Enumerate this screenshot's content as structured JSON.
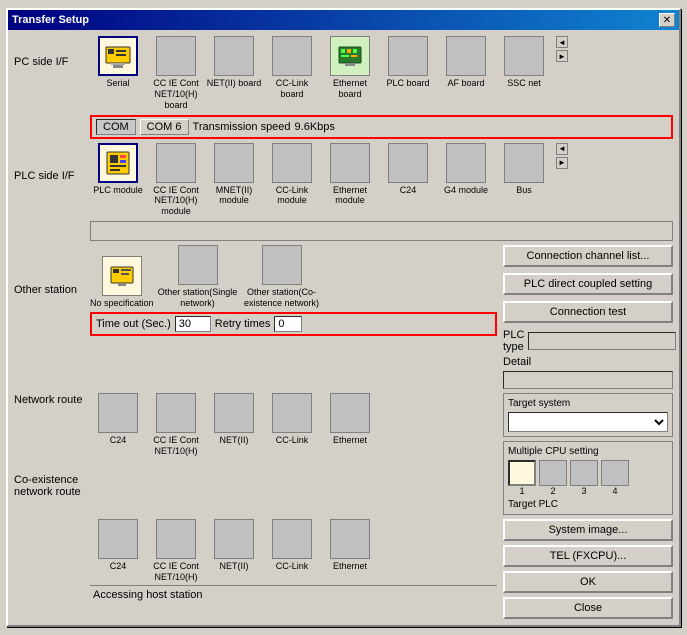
{
  "window": {
    "title": "Transfer Setup",
    "close_btn": "✕"
  },
  "pc_if": {
    "label": "PC side I/F",
    "icons": [
      {
        "id": "serial",
        "label": "Serial",
        "selected": true,
        "emoji": "🖥"
      },
      {
        "id": "cc_ie_cont_net10h_board",
        "label": "CC IE Cont NET/10(H) board",
        "selected": false,
        "emoji": ""
      },
      {
        "id": "netii_board",
        "label": "NET(II) board",
        "selected": false,
        "emoji": ""
      },
      {
        "id": "cc_link_board",
        "label": "CC-Link board",
        "selected": false,
        "emoji": ""
      },
      {
        "id": "ethernet_board",
        "label": "Ethernet board",
        "selected": false,
        "emoji": "🌐"
      },
      {
        "id": "plc_board",
        "label": "PLC board",
        "selected": false,
        "emoji": ""
      },
      {
        "id": "af_board",
        "label": "AF board",
        "selected": false,
        "emoji": ""
      },
      {
        "id": "ssc_net",
        "label": "SSC net",
        "selected": false,
        "emoji": ""
      }
    ],
    "com_bar": {
      "com_label": "COM",
      "com6_label": "COM 6",
      "speed_label": "Transmission speed",
      "speed_value": "9.6Kbps"
    }
  },
  "plc_if": {
    "label": "PLC side I/F",
    "icons": [
      {
        "id": "plc_module",
        "label": "PLC module",
        "selected": true,
        "emoji": "📋"
      },
      {
        "id": "cc_ie_cont_net10h_module",
        "label": "CC IE Cont NET/10(H) module",
        "selected": false,
        "emoji": ""
      },
      {
        "id": "mnetii_module",
        "label": "MNET(II) module",
        "selected": false,
        "emoji": ""
      },
      {
        "id": "cc_link_module",
        "label": "CC-Link module",
        "selected": false,
        "emoji": ""
      },
      {
        "id": "ethernet_module",
        "label": "Ethernet module",
        "selected": false,
        "emoji": ""
      },
      {
        "id": "c24_module",
        "label": "C24",
        "selected": false,
        "emoji": ""
      },
      {
        "id": "g4_module",
        "label": "G4 module",
        "selected": false,
        "emoji": ""
      },
      {
        "id": "bus_module",
        "label": "Bus",
        "selected": false,
        "emoji": ""
      }
    ]
  },
  "other_station": {
    "label": "Other station",
    "icons": [
      {
        "id": "no_spec",
        "label": "No specification",
        "selected": true,
        "emoji": "💾"
      },
      {
        "id": "single_network",
        "label": "Other station(Single network)",
        "selected": false,
        "emoji": ""
      },
      {
        "id": "co_exist_network",
        "label": "Other station(Co-existence network)",
        "selected": false,
        "emoji": ""
      }
    ],
    "timeout_label": "Time out (Sec.)",
    "timeout_value": "30",
    "retry_label": "Retry times",
    "retry_value": "0"
  },
  "network_route": {
    "label": "Network route",
    "icons": [
      {
        "id": "c24",
        "label": "C24",
        "emoji": ""
      },
      {
        "id": "cc_ie_cont_net10h",
        "label": "CC IE Cont NET/10(H)",
        "emoji": ""
      },
      {
        "id": "netii",
        "label": "NET(II)",
        "emoji": ""
      },
      {
        "id": "cc_link",
        "label": "CC-Link",
        "emoji": ""
      },
      {
        "id": "ethernet",
        "label": "Ethernet",
        "emoji": ""
      }
    ]
  },
  "co_exist_route": {
    "label": "Co-existence network route",
    "icons": [
      {
        "id": "c24_co",
        "label": "C24",
        "emoji": ""
      },
      {
        "id": "cc_ie_cont_co",
        "label": "CC IE Cont NET/10(H)",
        "emoji": ""
      },
      {
        "id": "netii_co",
        "label": "NET(II)",
        "emoji": ""
      },
      {
        "id": "cc_link_co",
        "label": "CC-Link",
        "emoji": ""
      },
      {
        "id": "ethernet_co",
        "label": "Ethernet",
        "emoji": ""
      }
    ]
  },
  "right_panel": {
    "connection_channel_btn": "Connection  channel list...",
    "plc_direct_btn": "PLC direct coupled setting",
    "connection_test_btn": "Connection test",
    "plc_type_label": "PLC type",
    "plc_type_value": "",
    "detail_label": "Detail",
    "detail_value": "",
    "system_image_btn": "System  image...",
    "tel_btn": "TEL (FXCPU)...",
    "ok_btn": "OK",
    "close_btn": "Close",
    "target_system": {
      "title": "Target system",
      "value": ""
    },
    "multi_cpu": {
      "title": "Multiple CPU setting",
      "buttons": [
        "1",
        "2",
        "3",
        "4"
      ]
    },
    "target_plc": {
      "title": "Target PLC",
      "value": ""
    }
  },
  "accessing_host": "Accessing host station"
}
